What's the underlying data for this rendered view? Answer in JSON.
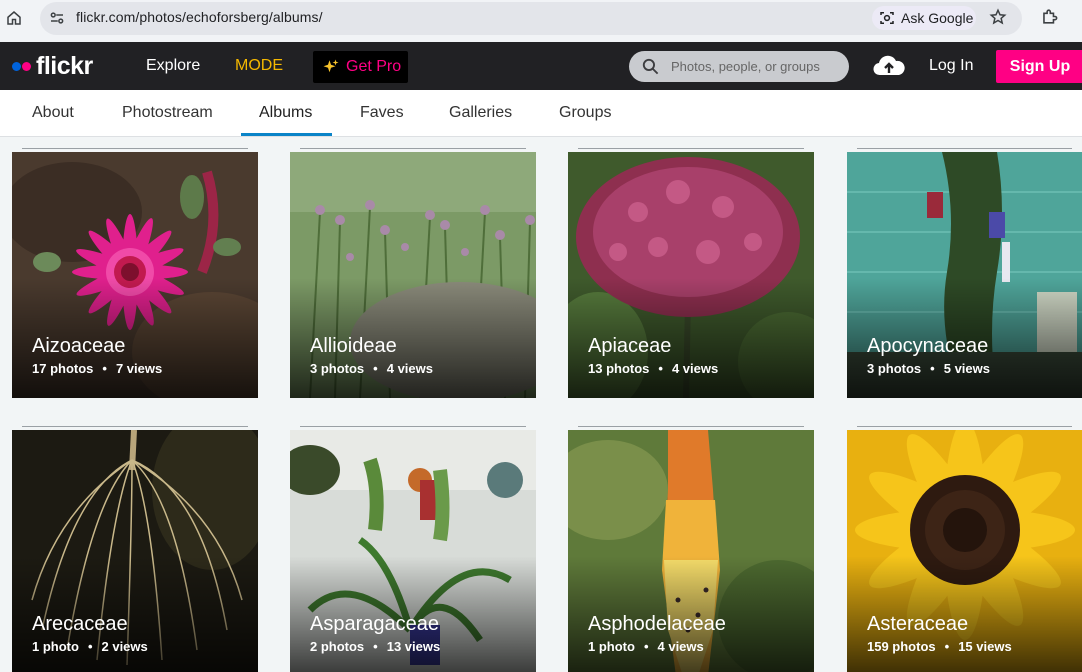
{
  "browser": {
    "url": "flickr.com/photos/echoforsberg/albums/",
    "ask_google": "Ask Google"
  },
  "nav": {
    "logo": "flickr",
    "explore": "Explore",
    "mode": "MODE",
    "get_pro": "Get Pro",
    "search_placeholder": "Photos, people, or groups",
    "login": "Log In",
    "signup": "Sign Up"
  },
  "tabs": [
    {
      "label": "About"
    },
    {
      "label": "Photostream"
    },
    {
      "label": "Albums"
    },
    {
      "label": "Faves"
    },
    {
      "label": "Galleries"
    },
    {
      "label": "Groups"
    }
  ],
  "active_tab": "Albums",
  "colors": {
    "accent_pink": "#ff0084",
    "accent_blue": "#0063dc",
    "mode_gold": "#f5b800",
    "tab_underline": "#0a84c8"
  },
  "albums": [
    {
      "title": "Aizoaceae",
      "photos": "17 photos",
      "views": "7 views"
    },
    {
      "title": "Allioideae",
      "photos": "3 photos",
      "views": "4 views"
    },
    {
      "title": "Apiaceae",
      "photos": "13 photos",
      "views": "4 views"
    },
    {
      "title": "Apocynaceae",
      "photos": "3 photos",
      "views": "5 views"
    },
    {
      "title": "Arecaceae",
      "photos": "1 photo",
      "views": "2 views"
    },
    {
      "title": "Asparagaceae",
      "photos": "2 photos",
      "views": "13 views"
    },
    {
      "title": "Asphodelaceae",
      "photos": "1 photo",
      "views": "4 views"
    },
    {
      "title": "Asteraceae",
      "photos": "159 photos",
      "views": "15 views"
    }
  ]
}
